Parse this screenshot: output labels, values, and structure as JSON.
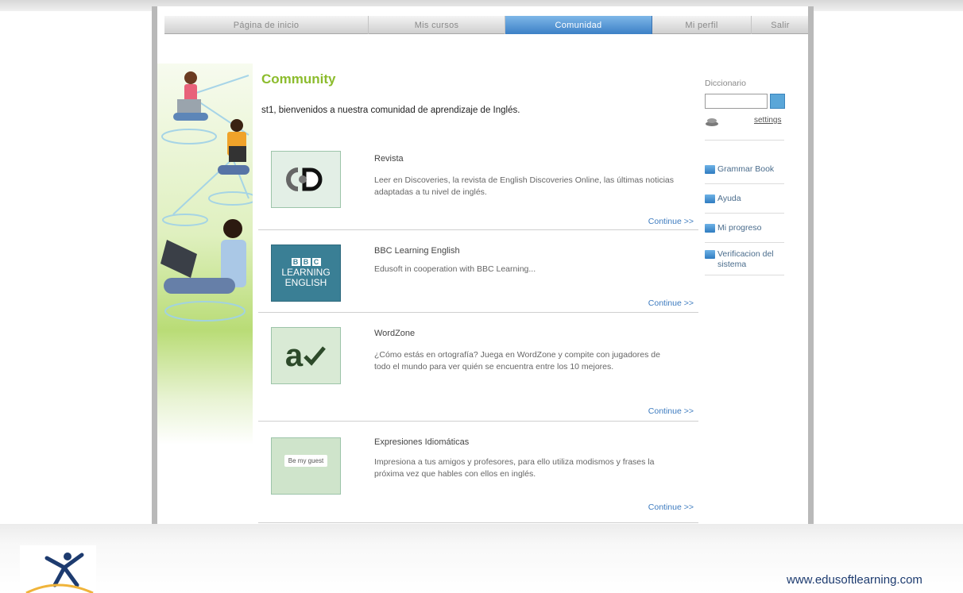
{
  "nav": {
    "items": [
      {
        "label": "Página de inicio",
        "active": false
      },
      {
        "label": "Mis cursos",
        "active": false
      },
      {
        "label": "Comunidad",
        "active": true
      },
      {
        "label": "Mi perfil",
        "active": false
      },
      {
        "label": "Salir",
        "active": false
      }
    ]
  },
  "main": {
    "title": "Community",
    "welcome": "st1, bienvenidos a nuestra comunidad de aprendizaje de Inglés.",
    "entries": [
      {
        "title": "Revista",
        "description": "Leer en Discoveries, la revista de English Discoveries Online, las últimas noticias adaptadas a tu nivel de inglés.",
        "continue": "Continue >>",
        "icon": "discoveries-logo-icon"
      },
      {
        "title": "BBC Learning English",
        "description": "Edusoft in cooperation with BBC Learning...",
        "continue": "Continue >>",
        "icon": "bbc-learning-english-logo",
        "logo_lines": [
          "BBC",
          "LEARNING",
          "ENGLISH"
        ]
      },
      {
        "title": "WordZone",
        "description": "¿Cómo estás en ortografía? Juega en WordZone y compite con jugadores de todo el mundo para ver quién se encuentra entre los 10 mejores.",
        "continue": "Continue >>",
        "icon": "wordzone-a-check-icon",
        "logo_text": "a"
      },
      {
        "title": "Expresiones Idiomáticas",
        "description": "Impresiona a tus amigos y profesores, para ello utiliza modismos y frases la próxima vez que hables con ellos en inglés.",
        "continue": "Continue >>",
        "icon": "speech-bubble-icon",
        "bubble_text": "Be my guest"
      }
    ]
  },
  "sidebar": {
    "dictionary_label": "Diccionario",
    "dictionary_value": "",
    "settings_label": "settings",
    "links": [
      {
        "label": "Grammar Book",
        "icon": "book-icon"
      },
      {
        "label": "Ayuda",
        "icon": "help-icon"
      },
      {
        "label": "Mi progreso",
        "icon": "progress-icon"
      },
      {
        "label": "Verificacion del sistema",
        "icon": "system-check-icon"
      }
    ]
  },
  "footer": {
    "url": "www.edusoftlearning.com",
    "logo": "edusoft-figure-logo"
  },
  "colors": {
    "accent_green": "#8cbc2d",
    "nav_active": "#3c80c6",
    "link_blue": "#3d7bbf",
    "url_navy": "#1d3b6f"
  }
}
